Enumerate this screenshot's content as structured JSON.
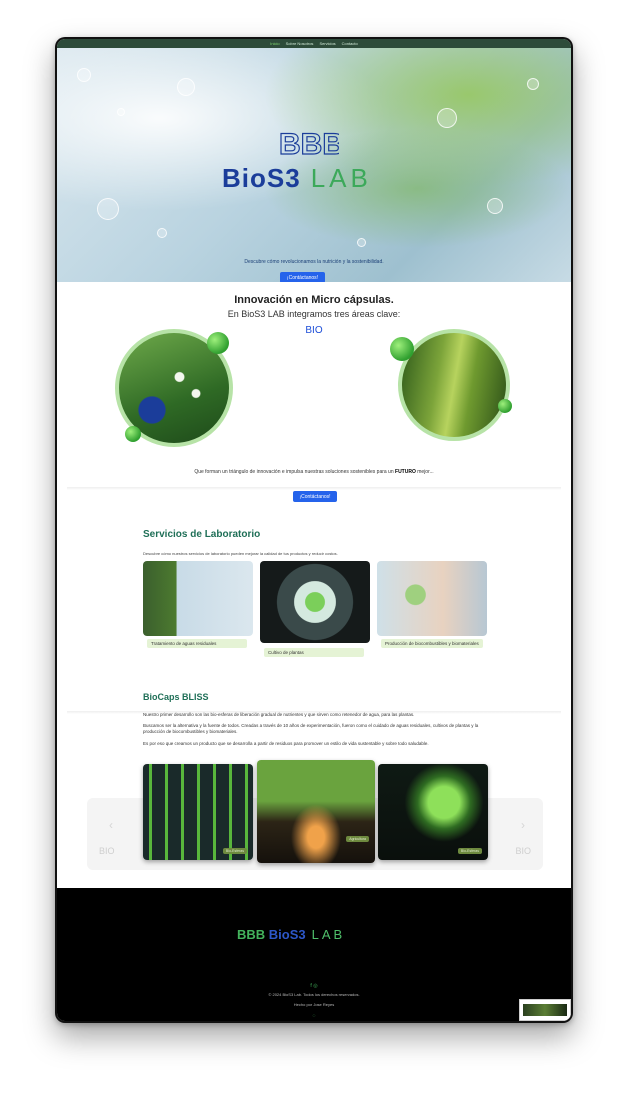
{
  "nav": {
    "items": [
      "Inicio",
      "Sobre Nosotros",
      "Servicios",
      "Contacto"
    ]
  },
  "hero": {
    "logo_mark": "BBB",
    "logo_bio": "BioS3",
    "logo_lab": "LAB",
    "subtitle": "Descubre cómo revolucionamos la nutrición y la sostenibilidad.",
    "cta": "¡Contáctanos!"
  },
  "intro": {
    "title": "Innovación en Micro cápsulas.",
    "subtitle": "En BioS3 LAB integramos tres áreas clave:",
    "area": "BIO",
    "triangle_text_before": "Que forman un triángulo de innovación e impulsa nuestras soluciones sostenibles para un ",
    "triangle_text_bold": "FUTURO",
    "triangle_text_after": " mejor...",
    "cta": "¡Contáctanos!"
  },
  "services": {
    "title": "Servicios de Laboratorio",
    "description": "Descubre cómo nuestros servicios de laboratorio pueden mejorar la calidad de tus productos y reducir costos.",
    "cards": [
      {
        "label": "Tratamiento de aguas residuales"
      },
      {
        "label": "Cultivo de plantas"
      },
      {
        "label": "Producción de biocombustibles y biomateriales"
      }
    ]
  },
  "biocaps": {
    "title": "BioCaps BLISS",
    "p1": "Nuestro primer desarrollo son las bio-esferas de liberación gradual de nutrientes y que sirven como retenedor de agua, para las plantas.",
    "p2": "Buscamos ser la alternativa y la fuente de todos. Creadas a través de 10 años de experimentación, fueron como el cuidado de aguas residuales, cultivos de plantas y la producción de biocombustibles y biomateriales.",
    "p3": "Es por eso que creamos un producto que se desarrolla a partir de residuos para promover un estilo de vida sustentable y sobre todo saludable.",
    "carousel_tags": [
      "Bio-Esferas",
      "Agricultura",
      "Bio-Esferas"
    ],
    "carousel_side_labels": [
      "BIO",
      "BIO"
    ]
  },
  "footer": {
    "logo_mark": "BBB",
    "logo_bio": "BioS3",
    "logo_lab": "LAB",
    "copyright": "© 2024 BioS3 Lab. Todos los derechos reservados.",
    "credit": "Hecho por Jose Reyes"
  },
  "colors": {
    "nav": "#2d4b3a",
    "accent": "#2563eb",
    "green": "#3ca95a",
    "navy": "#1b3d9a"
  }
}
